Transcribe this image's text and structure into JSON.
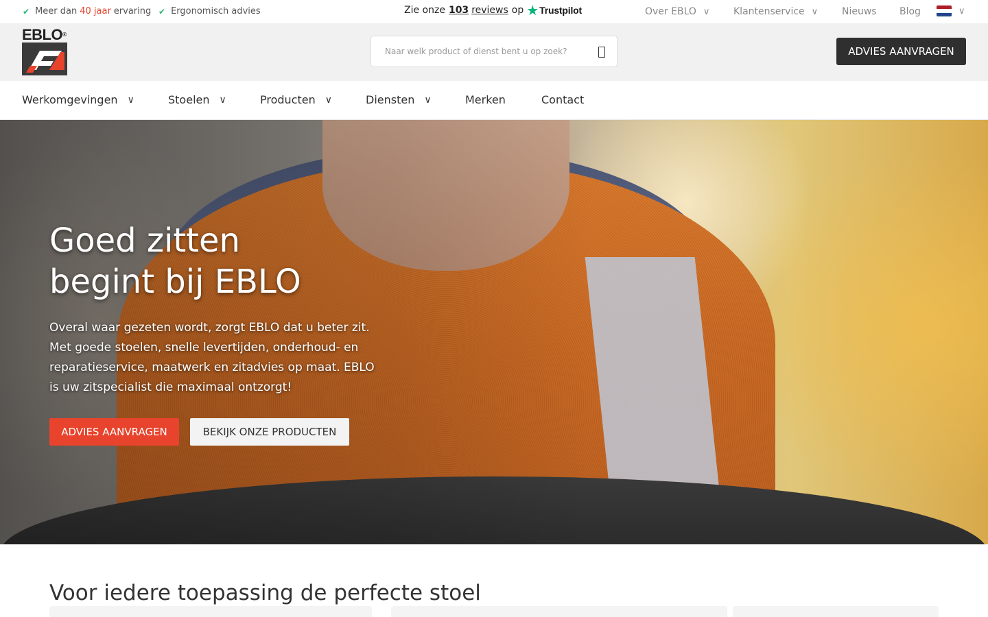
{
  "topbar": {
    "usp_experience": {
      "before": "Meer dan",
      "highlight": "40 jaar",
      "after": "ervaring"
    },
    "usp_advice": "Ergonomisch advies",
    "trustpilot": {
      "prefix": "Zie onze",
      "count": "103",
      "reviews": "reviews",
      "suffix": "op",
      "brand": "Trustpilot"
    },
    "util_nav": [
      {
        "label": "Over EBLO",
        "has_dropdown": true
      },
      {
        "label": "Klantenservice",
        "has_dropdown": true
      },
      {
        "label": "Nieuws",
        "has_dropdown": false
      },
      {
        "label": "Blog",
        "has_dropdown": false
      }
    ],
    "language": {
      "flag": "nl-flag-icon",
      "has_dropdown": true
    }
  },
  "header": {
    "logo_text": "EBLO",
    "search": {
      "placeholder": "Naar welk product of dienst bent u op zoek?",
      "value": ""
    },
    "cta_label": "ADVIES AANVRAGEN"
  },
  "main_nav": [
    {
      "label": "Werkomgevingen",
      "has_dropdown": true
    },
    {
      "label": "Stoelen",
      "has_dropdown": true
    },
    {
      "label": "Producten",
      "has_dropdown": true
    },
    {
      "label": "Diensten",
      "has_dropdown": true
    },
    {
      "label": "Merken",
      "has_dropdown": false
    },
    {
      "label": "Contact",
      "has_dropdown": false
    }
  ],
  "hero": {
    "title_line1": "Goed zitten",
    "title_line2": "begint bij EBLO",
    "text": "Overal waar gezeten wordt, zorgt EBLO dat u beter zit. Met goede stoelen, snelle levertijden, onderhoud- en reparatieservice, maatwerk en zitadvies op maat. EBLO is uw zitspecialist die maximaal ontzorgt!",
    "primary_button": "ADVIES AANVRAGEN",
    "secondary_button": "BEKIJK ONZE PRODUCTEN"
  },
  "section": {
    "title": "Voor iedere toepassing de perfecte stoel"
  },
  "colors": {
    "accent_red": "#e8432c",
    "dark_button": "#2f2f2f",
    "tick_green": "#2bb673",
    "trustpilot_green": "#00b67a"
  }
}
